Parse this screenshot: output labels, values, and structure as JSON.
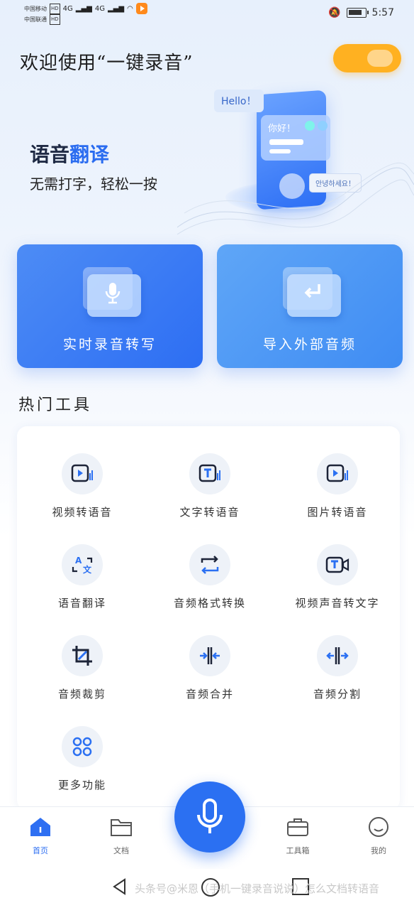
{
  "status_bar": {
    "carrier1": "中国移动",
    "carrier2": "中国联通",
    "net1": "HD",
    "net2": "HD",
    "signal1": "4G",
    "signal2": "4G",
    "time": "5:57"
  },
  "header": {
    "welcome": "欢迎使用“一键录音”"
  },
  "banner": {
    "title_part1": "语音",
    "title_part2": "翻译",
    "subtitle": "无需打字，轻松一按",
    "bubble_hello": "Hello！",
    "bubble_hi": "你好！",
    "bubble_ko": "안녕하세요！"
  },
  "cards": {
    "record": "实时录音转写",
    "import": "导入外部音频"
  },
  "section": {
    "title": "热门工具"
  },
  "tools": [
    {
      "label": "视频转语音",
      "icon": "video-to-audio-icon"
    },
    {
      "label": "文字转语音",
      "icon": "text-to-speech-icon"
    },
    {
      "label": "图片转语音",
      "icon": "image-to-audio-icon"
    },
    {
      "label": "语音翻译",
      "icon": "translate-icon"
    },
    {
      "label": "音频格式转换",
      "icon": "format-convert-icon"
    },
    {
      "label": "视频声音转文字",
      "icon": "video-text-icon"
    },
    {
      "label": "音频裁剪",
      "icon": "crop-icon"
    },
    {
      "label": "音频合并",
      "icon": "merge-icon"
    },
    {
      "label": "音频分割",
      "icon": "split-icon"
    },
    {
      "label": "更多功能",
      "icon": "more-icon"
    }
  ],
  "tabbar": {
    "home": "首页",
    "files": "文档",
    "toolbox": "工具箱",
    "mine": "我的"
  },
  "watermark": "头条号@米恩（手机一键录音说说）怎么文档转语音",
  "colors": {
    "accent": "#2b70f2",
    "toggle": "#ffb121"
  }
}
